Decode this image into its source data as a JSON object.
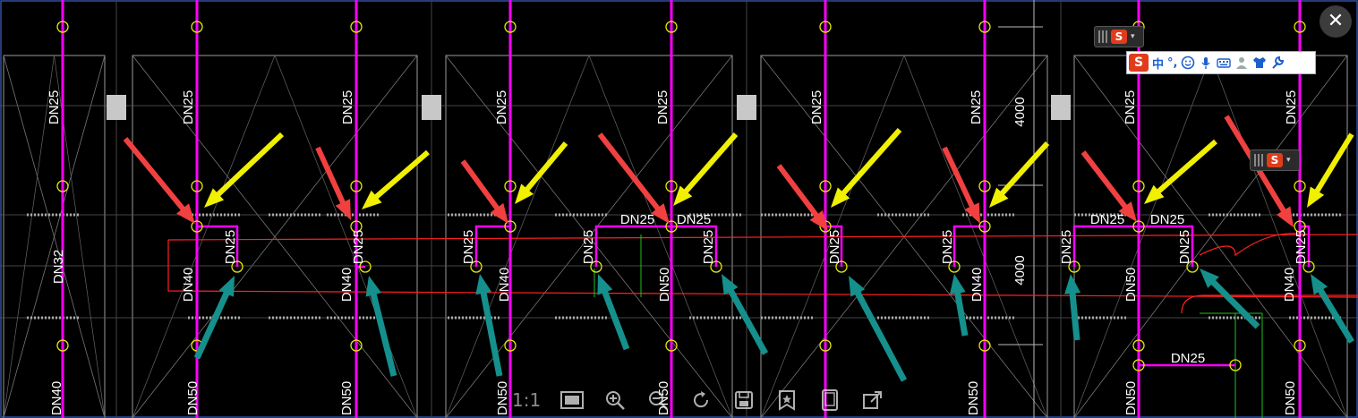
{
  "window": {
    "close_label": "✕"
  },
  "ime": {
    "logo": "S",
    "mode_label": "中",
    "punct_label": "°,"
  },
  "toolbar": {
    "zoom_label": "1:1"
  },
  "drawing": {
    "labels": {
      "dn25": "DN25",
      "dn32": "DN32",
      "dn40": "DN40",
      "dn50": "DN50",
      "dim_4000": "4000"
    },
    "colors": {
      "background": "#000000",
      "pipe": "#ff00ff",
      "grid": "#9a9a9a",
      "red_line": "#ff2020",
      "node": "#e8e800",
      "arrow_red": "#f04040",
      "arrow_yellow": "#f0f000",
      "arrow_teal": "#15908c",
      "green": "#20c020"
    }
  }
}
